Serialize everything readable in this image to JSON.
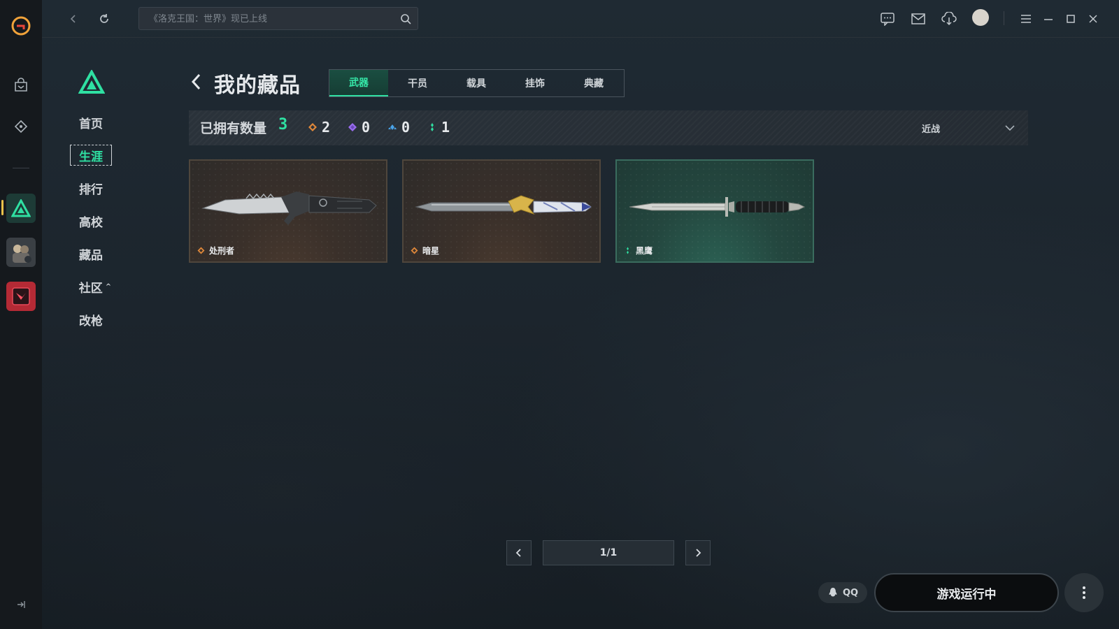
{
  "topbar": {
    "search_placeholder": "《洛克王国：世界》现已上线",
    "icons": [
      "back-icon",
      "refresh-icon",
      "search-icon",
      "chat-icon",
      "mail-icon",
      "download-icon",
      "avatar",
      "menu-icon",
      "minimize-icon",
      "maximize-icon",
      "close-icon"
    ]
  },
  "rail": {
    "icons": [
      "wegame-logo",
      "store-icon",
      "library-icon",
      "game-valorant-active",
      "game-pubg",
      "game-valorant-red"
    ]
  },
  "sidenav": {
    "items": [
      {
        "label": "首页"
      },
      {
        "label": "生涯",
        "active": true
      },
      {
        "label": "排行"
      },
      {
        "label": "高校"
      },
      {
        "label": "藏品"
      },
      {
        "label": "社区",
        "caret": "^"
      },
      {
        "label": "改枪"
      }
    ]
  },
  "header": {
    "title": "我的藏品",
    "tabs": [
      {
        "label": "武器",
        "active": true
      },
      {
        "label": "干员"
      },
      {
        "label": "载具"
      },
      {
        "label": "挂饰"
      },
      {
        "label": "典藏"
      }
    ]
  },
  "stats": {
    "owned_label": "已拥有数量",
    "owned_count": "3",
    "rarities": [
      {
        "color": "#e0883a",
        "count": "2"
      },
      {
        "color": "#9a6cf0",
        "count": "0"
      },
      {
        "color": "#4aa3e8",
        "count": "0"
      },
      {
        "color": "#2fe0a2",
        "count": "1"
      }
    ],
    "filter_label": "近战"
  },
  "cards": [
    {
      "name": "处刑者",
      "rarity_color": "#e0883a"
    },
    {
      "name": "暗星",
      "rarity_color": "#e0883a"
    },
    {
      "name": "黑鹰",
      "rarity_color": "#2fe0a2"
    }
  ],
  "pagination": {
    "indicator": "1/1"
  },
  "bottom": {
    "qq_label": "QQ",
    "run_label": "游戏运行中"
  }
}
